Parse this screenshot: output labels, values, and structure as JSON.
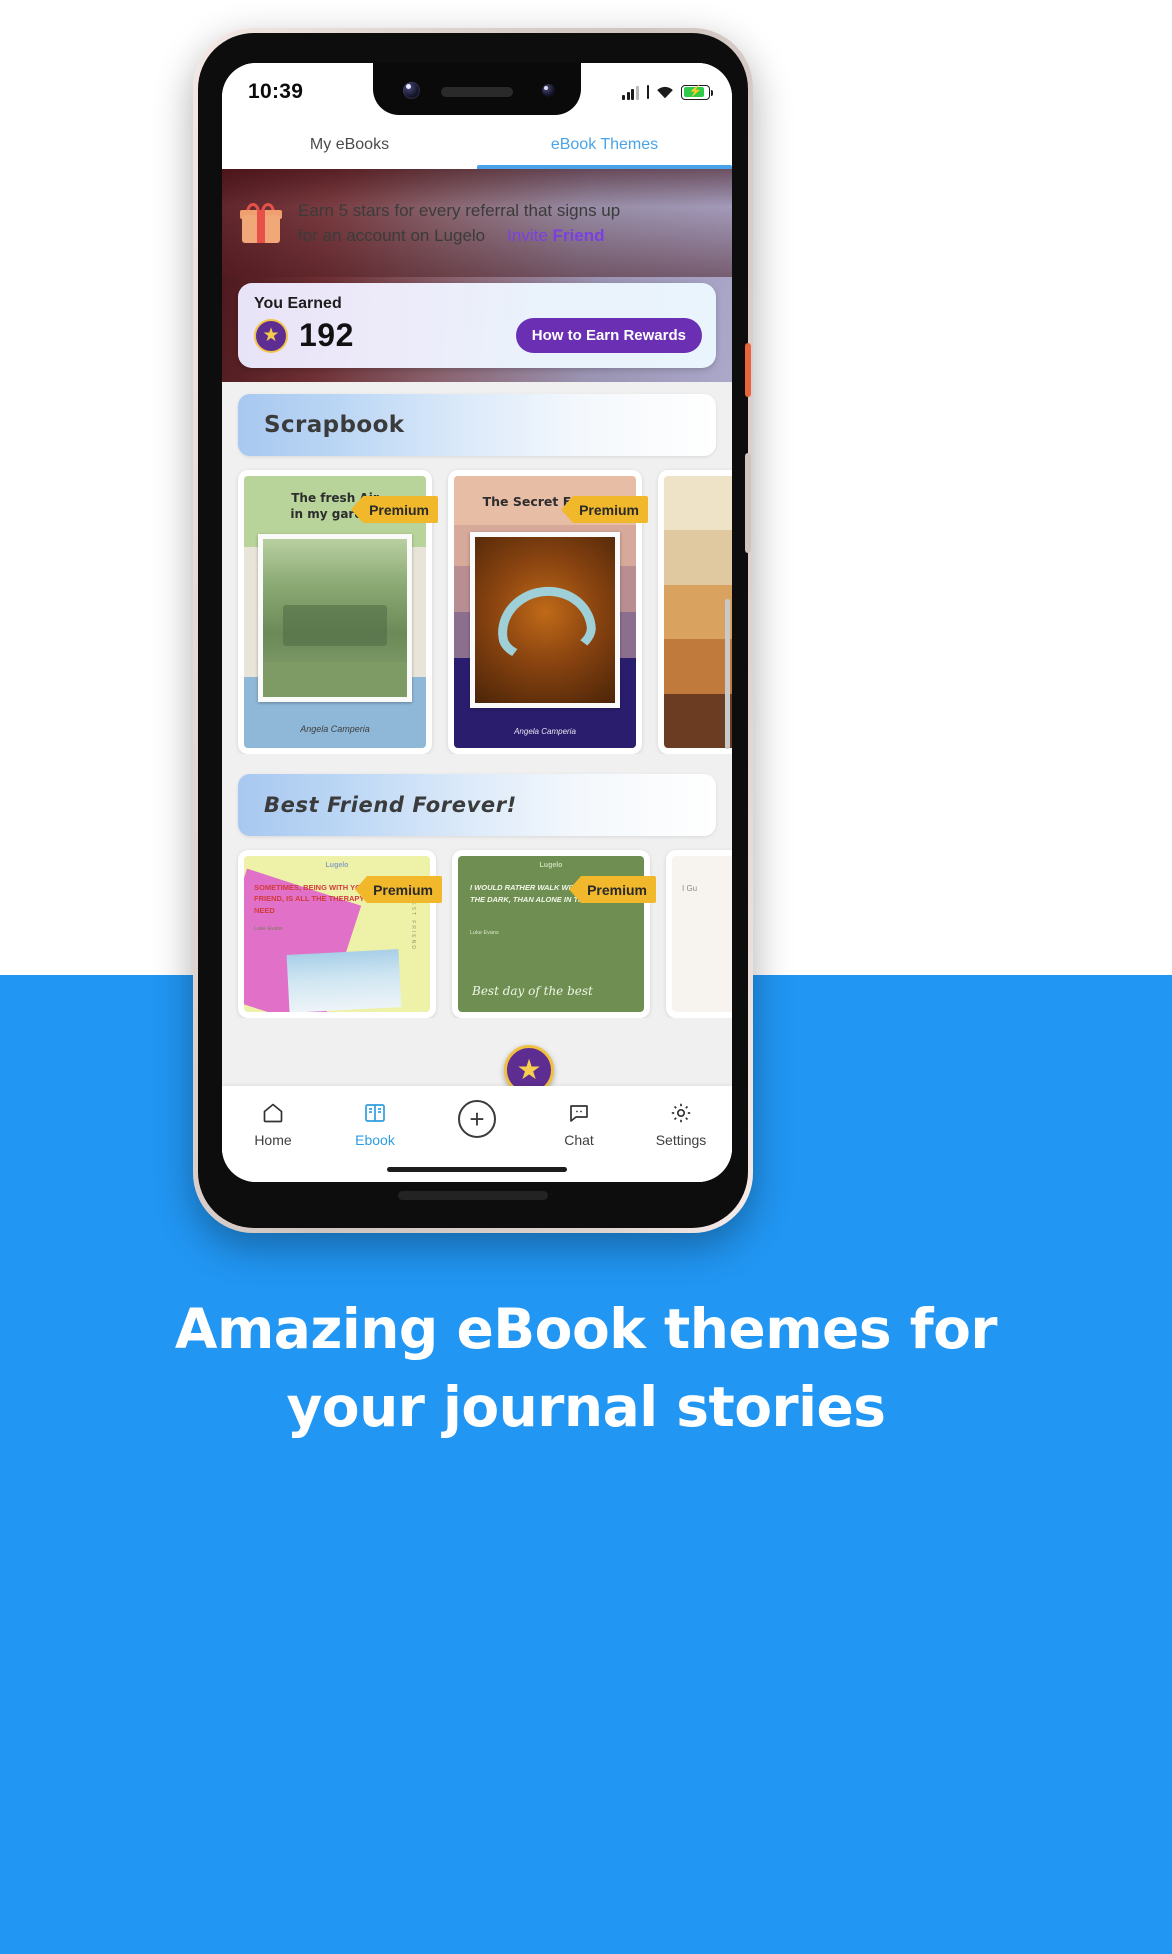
{
  "statusbar": {
    "clock": "10:39",
    "signal_icon": "signal-bars-icon",
    "wifi_icon": "wifi-icon",
    "battery_icon": "battery-charging-icon"
  },
  "tabs": [
    {
      "label": "My eBooks",
      "active": false
    },
    {
      "label": "eBook Themes",
      "active": true
    }
  ],
  "referral_banner": {
    "gift_icon": "gift-icon",
    "line1": "Earn 5 stars for every referral that signs up",
    "line2": "for an account on Lugelo",
    "invite_label_1": "Invite",
    "invite_label_2": "Friend"
  },
  "earned_card": {
    "label": "You Earned",
    "star_icon": "star-badge-icon",
    "amount": "192",
    "button_label": "How to Earn Rewards"
  },
  "sections": [
    {
      "title": "Scrapbook",
      "cards": [
        {
          "badge": "Premium",
          "title_line1": "The fresh Air",
          "title_line2": "in my garden",
          "signature": "Angela Camperia"
        },
        {
          "badge": "Premium",
          "title_line1": "The Secret Forest",
          "title_line2": "",
          "signature": "Angela Camperia"
        },
        {
          "badge": "",
          "title_line1": "",
          "title_line2": "",
          "signature": ""
        }
      ]
    },
    {
      "title": "Best Friend Forever!",
      "cards": [
        {
          "badge": "Premium",
          "brand": "Lugelo",
          "quote": "SOMETIMES, BEING WITH YOUR BEST FRIEND, IS ALL THE THERAPY YOU NEED",
          "author": "Luke Evans",
          "vertical": "BEST FRIEND"
        },
        {
          "badge": "Premium",
          "brand": "Lugelo",
          "quote": "I WOULD RATHER WALK WITH A FRIEND IN THE DARK, THAN ALONE IN THE LIGHT",
          "author": "Luke Evans",
          "handwriting": "Best day of the best"
        },
        {
          "badge": "",
          "brand": "",
          "quote": "I Gu",
          "author": "",
          "vertical": ""
        }
      ]
    }
  ],
  "medal": {
    "star_icon": "star-medal-icon"
  },
  "bottom_nav": [
    {
      "label": "Home",
      "icon": "home-icon",
      "active": false
    },
    {
      "label": "Ebook",
      "icon": "book-icon",
      "active": true
    },
    {
      "label": "",
      "icon": "plus-circle-icon",
      "active": false
    },
    {
      "label": "Chat",
      "icon": "chat-icon",
      "active": false
    },
    {
      "label": "Settings",
      "icon": "gear-icon",
      "active": false
    }
  ],
  "caption": {
    "line1": "Amazing eBook themes for",
    "line2": "your journal stories"
  },
  "colors": {
    "page_blue": "#2196f3",
    "accent_blue": "#4aa3e8",
    "purple": "#6a2fb3",
    "invite_purple": "#7b3fe4",
    "premium_gold": "#f0b82a",
    "battery_green": "#2ecc4a"
  }
}
